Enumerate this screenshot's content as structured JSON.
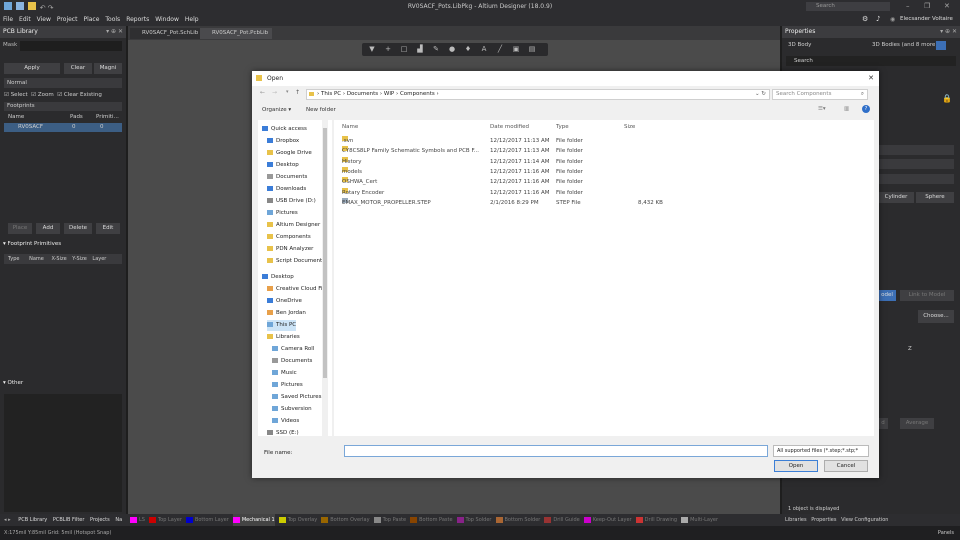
{
  "window": {
    "title": "RV0SACF_Pots.LibPkg - Altium Designer (18.0.9)",
    "search": "Search",
    "user": "Elecsander Voltaire"
  },
  "menu": [
    "File",
    "Edit",
    "View",
    "Project",
    "Place",
    "Tools",
    "Reports",
    "Window",
    "Help"
  ],
  "tabs": [
    "RV0SACF_Pot.SchLib",
    "RV0SACF_Pot.PcbLib"
  ],
  "left_panel": {
    "title": "PCB Library",
    "mask_label": "Mask",
    "apply": "Apply",
    "clear": "Clear",
    "magnify": "Magni",
    "mode": "Normal",
    "checks": [
      "Select",
      "Zoom",
      "Clear Existing"
    ],
    "footprints_label": "Footprints",
    "columns": [
      "Name",
      "Pads",
      "Primiti..."
    ],
    "row": {
      "name": "RV0SACF",
      "pads": "0",
      "prims": "0"
    },
    "actions": [
      "Place",
      "Add",
      "Delete",
      "Edit"
    ],
    "primitives_label": "Footprint Primitives",
    "prim_cols": [
      "Type",
      "Name",
      "X-Size",
      "Y-Size",
      "Layer"
    ],
    "other_label": "Other"
  },
  "right_panel": {
    "title": "Properties",
    "body": "3D Body",
    "bodies": "3D Bodies (and 8 more)",
    "search": "Search",
    "cylinder": "Cylinder",
    "sphere": "Sphere",
    "model": "odel",
    "link": "Link to Model",
    "choose": "Choose...",
    "z": "Z",
    "ad": "d",
    "average": "Average",
    "status": "1 object is displayed",
    "bottom_tabs": [
      "Libraries",
      "Properties",
      "View Configuration"
    ]
  },
  "toolbar_icons": [
    "filter-icon",
    "plus-icon",
    "rect-icon",
    "chart-icon",
    "pen-icon",
    "circle-icon",
    "pin-icon",
    "text-icon",
    "line-icon",
    "rect-select-icon",
    "frame-icon"
  ],
  "dialog": {
    "title": "Open",
    "path": [
      "This PC",
      "Documents",
      "WIP",
      "Components"
    ],
    "search_placeholder": "Search Components",
    "organize": "Organize ▾",
    "new_folder": "New folder",
    "columns": [
      "Name",
      "Date modified",
      "Type",
      "Size"
    ],
    "nav": [
      {
        "label": "Quick access",
        "color": "#3b7dd8"
      },
      {
        "label": "Dropbox",
        "color": "#3b7dd8"
      },
      {
        "label": "Google Drive",
        "color": "#e8c24a"
      },
      {
        "label": "Desktop",
        "color": "#3b7dd8"
      },
      {
        "label": "Documents",
        "color": "#999"
      },
      {
        "label": "Downloads",
        "color": "#3b7dd8"
      },
      {
        "label": "USB Drive (D:)",
        "color": "#888"
      },
      {
        "label": "Pictures",
        "color": "#6fa6d8"
      },
      {
        "label": "Altium Designer",
        "color": "#e8c24a"
      },
      {
        "label": "Components",
        "color": "#e8c24a"
      },
      {
        "label": "PDN Analyzer",
        "color": "#e8c24a"
      },
      {
        "label": "Script Documents",
        "color": "#e8c24a"
      },
      {
        "label": "Desktop",
        "color": "#3b7dd8"
      },
      {
        "label": "Creative Cloud Fi",
        "color": "#e8a04a"
      },
      {
        "label": "OneDrive",
        "color": "#3b7dd8"
      },
      {
        "label": "Ben Jordan",
        "color": "#e8a04a"
      },
      {
        "label": "This PC",
        "color": "#6fa6d8"
      },
      {
        "label": "Libraries",
        "color": "#e8c24a"
      },
      {
        "label": "Camera Roll",
        "color": "#6fa6d8"
      },
      {
        "label": "Documents",
        "color": "#999"
      },
      {
        "label": "Music",
        "color": "#6fa6d8"
      },
      {
        "label": "Pictures",
        "color": "#6fa6d8"
      },
      {
        "label": "Saved Pictures",
        "color": "#6fa6d8"
      },
      {
        "label": "Subversion",
        "color": "#6fa6d8"
      },
      {
        "label": "Videos",
        "color": "#6fa6d8"
      },
      {
        "label": "SSD (E:)",
        "color": "#888"
      }
    ],
    "files": [
      {
        "name": ".svn",
        "date": "12/12/2017 11:13 AM",
        "type": "File folder",
        "size": ""
      },
      {
        "name": "CY8CS8LP Family Schematic Symbols and PCB F...",
        "date": "12/12/2017 11:13 AM",
        "type": "File folder",
        "size": ""
      },
      {
        "name": "History",
        "date": "12/12/2017 11:14 AM",
        "type": "File folder",
        "size": ""
      },
      {
        "name": "models",
        "date": "12/12/2017 11:16 AM",
        "type": "File folder",
        "size": ""
      },
      {
        "name": "OSHWA_Cert",
        "date": "12/12/2017 11:16 AM",
        "type": "File folder",
        "size": ""
      },
      {
        "name": "Rotary Encoder",
        "date": "12/12/2017 11:16 AM",
        "type": "File folder",
        "size": ""
      },
      {
        "name": "EMAX_MOTOR_PROPELLER.STEP",
        "date": "2/1/2016 8:29 PM",
        "type": "STEP File",
        "size": "8,432 KB"
      }
    ],
    "filename_label": "File name:",
    "filename_value": "",
    "filetype": "All supported files (*.step;*.stp;*",
    "open": "Open",
    "cancel": "Cancel"
  },
  "statusbar": {
    "tabs": [
      "PCB Library",
      "PCBLIB Filter",
      "Projects",
      "Na"
    ],
    "layers": [
      {
        "label": "LS",
        "color": "#ff00ff"
      },
      {
        "label": "Top Layer",
        "color": "#cc0000"
      },
      {
        "label": "Bottom Layer",
        "color": "#0000cc"
      },
      {
        "label": "Mechanical 1",
        "color": "#ff00ff"
      },
      {
        "label": "Top Overlay",
        "color": "#cccc00"
      },
      {
        "label": "Bottom Overlay",
        "color": "#996600"
      },
      {
        "label": "Top Paste",
        "color": "#888888"
      },
      {
        "label": "Bottom Paste",
        "color": "#884400"
      },
      {
        "label": "Top Solder",
        "color": "#882288"
      },
      {
        "label": "Bottom Solder",
        "color": "#aa6633"
      },
      {
        "label": "Drill Guide",
        "color": "#993333"
      },
      {
        "label": "Keep-Out Layer",
        "color": "#cc00cc"
      },
      {
        "label": "Drill Drawing",
        "color": "#cc3333"
      },
      {
        "label": "Multi-Layer",
        "color": "#aaaaaa"
      }
    ],
    "coords": "X:175mil Y:85mil   Grid: 5mil   (Hotspot Snap)",
    "panels": "Panels"
  }
}
